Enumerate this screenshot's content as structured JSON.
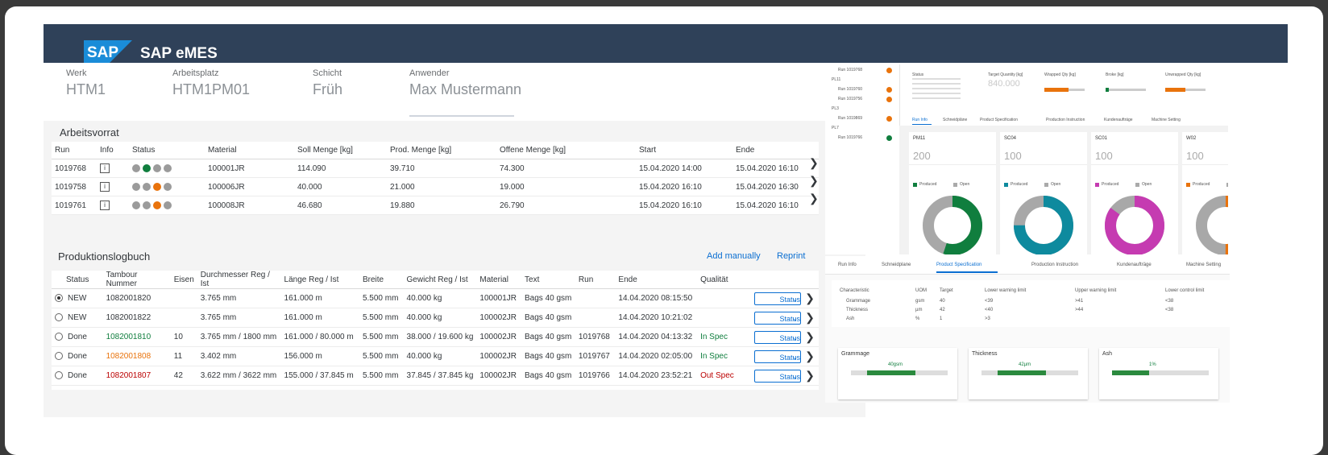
{
  "app": {
    "brand": "SAP",
    "title": "SAP eMES"
  },
  "header": {
    "fields": [
      {
        "label": "Werk",
        "value": "HTM1"
      },
      {
        "label": "Arbeitsplatz",
        "value": "HTM1PM01"
      },
      {
        "label": "Schicht",
        "value": "Früh"
      },
      {
        "label": "Anwender",
        "value": "Max Mustermann"
      }
    ]
  },
  "worklist": {
    "title": "Arbeitsvorrat",
    "columns": [
      "Run",
      "Info",
      "Status",
      "Material",
      "Soll Menge [kg]",
      "Prod. Menge [kg]",
      "Offene Menge [kg]",
      "Start",
      "Ende"
    ],
    "rows": [
      {
        "run": "1019768",
        "material": "100001JR",
        "soll": "114.090",
        "prod": "39.710",
        "offen": "74.300",
        "start": "15.04.2020 14:00",
        "ende": "15.04.2020 16:10",
        "status": [
          "#9b9b9b",
          "#107e3e",
          "#9b9b9b",
          "#9b9b9b"
        ]
      },
      {
        "run": "1019758",
        "material": "100006JR",
        "soll": "40.000",
        "prod": "21.000",
        "offen": "19.000",
        "start": "15.04.2020 16:10",
        "ende": "15.04.2020 16:30",
        "status": [
          "#9b9b9b",
          "#9b9b9b",
          "#e9730c",
          "#9b9b9b"
        ]
      },
      {
        "run": "1019761",
        "material": "100008JR",
        "soll": "46.680",
        "prod": "19.880",
        "offen": "26.790",
        "start": "15.04.2020 16:10",
        "ende": "15.04.2020 16:10",
        "status": [
          "#9b9b9b",
          "#9b9b9b",
          "#e9730c",
          "#9b9b9b"
        ]
      }
    ]
  },
  "logbook": {
    "title": "Produktionslogbuch",
    "add_manually": "Add manually",
    "reprint": "Reprint",
    "columns": [
      "Status",
      "Tambour Nummer",
      "Eisen",
      "Durchmesser Reg / Ist",
      "Länge Reg / Ist",
      "Breite",
      "Gewicht Reg / Ist",
      "Material",
      "Text",
      "Run",
      "Ende",
      "Qualität"
    ],
    "status_select": "Status",
    "rows": [
      {
        "selected": true,
        "status": "NEW",
        "tambour": "1082001820",
        "tcolor": "",
        "eisen": "",
        "durch": "3.765 mm",
        "laenge": "161.000 m",
        "breite": "5.500 mm",
        "gewicht": "40.000 kg",
        "material": "100001JR",
        "text": "Bags 40 gsm",
        "run": "",
        "ende": "14.04.2020 08:15:50",
        "quali": "",
        "qcolor": ""
      },
      {
        "selected": false,
        "status": "NEW",
        "tambour": "1082001822",
        "tcolor": "",
        "eisen": "",
        "durch": "3.765 mm",
        "laenge": "161.000 m",
        "breite": "5.500 mm",
        "gewicht": "40.000 kg",
        "material": "100002JR",
        "text": "Bags 40 gsm",
        "run": "",
        "ende": "14.04.2020 10:21:02",
        "quali": "",
        "qcolor": ""
      },
      {
        "selected": false,
        "status": "Done",
        "tambour": "1082001810",
        "tcolor": "green",
        "eisen": "10",
        "durch": "3.765 mm / 1800 mm",
        "laenge": "161.000 / 80.000 m",
        "breite": "5.500 mm",
        "gewicht": "38.000 / 19.600 kg",
        "material": "100002JR",
        "text": "Bags 40 gsm",
        "run": "1019768",
        "ende": "14.04.2020 04:13:32",
        "quali": "In Spec",
        "qcolor": "green"
      },
      {
        "selected": false,
        "status": "Done",
        "tambour": "1082001808",
        "tcolor": "orange",
        "eisen": "11",
        "durch": "3.402 mm",
        "laenge": "156.000 m",
        "breite": "5.500 mm",
        "gewicht": "40.000 kg",
        "material": "100002JR",
        "text": "Bags 40 gsm",
        "run": "1019767",
        "ende": "14.04.2020 02:05:00",
        "quali": "In Spec",
        "qcolor": "green"
      },
      {
        "selected": false,
        "status": "Done",
        "tambour": "1082001807",
        "tcolor": "red",
        "eisen": "42",
        "durch": "3.622 mm / 3622 mm",
        "laenge": "155.000 / 37.845 m",
        "breite": "5.500 mm",
        "gewicht": "37.845 / 37.845 kg",
        "material": "100002JR",
        "text": "Bags 40 gsm",
        "run": "1019766",
        "ende": "14.04.2020 23:52:21",
        "quali": "Out Spec",
        "qcolor": "red"
      }
    ]
  },
  "thumb_top": {
    "runs": [
      "Run 1019768",
      "PL11",
      "Run 1019760",
      "Run 1019756",
      "PL3",
      "Run 1019869",
      "PL7",
      "Run 1019766"
    ],
    "run_dots": [
      "#e9730c",
      "",
      "#e9730c",
      "#e9730c",
      "",
      "#e9730c",
      "",
      "#107e3e"
    ],
    "kpis": [
      "Status",
      "Target Quantity [kg]",
      "Wrapped Qty [kg]",
      "Broke [kg]",
      "Unwrapped Qty [kg]"
    ],
    "target_value": "840.000",
    "tabs": [
      "Run Info",
      "Schneidpläne",
      "Product Specification",
      "Production Instruction",
      "Kundenaufträge",
      "Machine Setting"
    ],
    "cards": [
      {
        "name": "PM11",
        "value": "200",
        "color": "#107e3e",
        "fraction": 0.55
      },
      {
        "name": "SC04",
        "value": "100",
        "color": "#0e8a9e",
        "fraction": 0.75
      },
      {
        "name": "SC01",
        "value": "100",
        "color": "#c53bb1",
        "fraction": 0.85
      },
      {
        "name": "W02",
        "value": "100",
        "color": "#e9730c",
        "fraction": 0.5
      }
    ],
    "legend_produced": "Produced",
    "legend_open": "Open"
  },
  "thumb_bottom": {
    "tabs": [
      "Run Info",
      "Schneidplane",
      "Product Specification",
      "Production Instruction",
      "Kundenaufträge",
      "Machine Setting"
    ],
    "columns": [
      "Characteristic",
      "UOM",
      "Target",
      "Lower warning limit",
      "Upper warning limit",
      "Lower control limit"
    ],
    "rows": [
      [
        "Grammage",
        "gsm",
        "40",
        "<39",
        ">41",
        "<38"
      ],
      [
        "Thickness",
        "µm",
        "42",
        "<40",
        ">44",
        "<38"
      ],
      [
        "Ash",
        "%",
        "1",
        ">3",
        "",
        ""
      ]
    ],
    "gauges": [
      {
        "name": "Grammage",
        "value": "40gsm"
      },
      {
        "name": "Thickness",
        "value": "42µm"
      },
      {
        "name": "Ash",
        "value": "1%"
      }
    ]
  }
}
